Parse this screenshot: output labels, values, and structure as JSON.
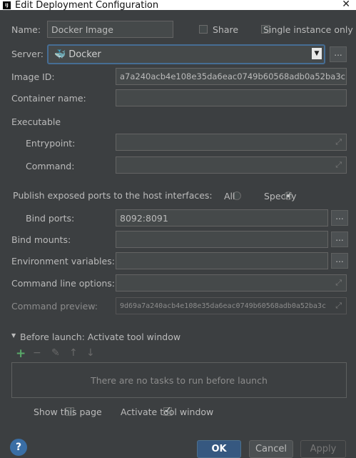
{
  "window": {
    "title": "Edit Deployment Configuration",
    "close_glyph": "✕"
  },
  "name": {
    "label": "Name:",
    "value": "Docker Image"
  },
  "share": {
    "label": "Share"
  },
  "single_instance": {
    "label": "Single instance only"
  },
  "server": {
    "label": "Server:",
    "value": "Docker",
    "more": "..."
  },
  "image_id": {
    "label": "Image ID:",
    "value": "a7a240acb4e108e35da6eac0749b60568adb0a52ba3c"
  },
  "container_name": {
    "label": "Container name:",
    "value": ""
  },
  "executable": {
    "section": "Executable",
    "entrypoint": {
      "label": "Entrypoint:",
      "value": ""
    },
    "command": {
      "label": "Command:",
      "value": ""
    }
  },
  "publish": {
    "label": "Publish exposed ports to the host interfaces:",
    "all": "All",
    "specify": "Specify",
    "selected": "Specify"
  },
  "bind_ports": {
    "label": "Bind ports:",
    "value": "8092:8091",
    "more": "..."
  },
  "bind_mounts": {
    "label": "Bind mounts:",
    "value": "",
    "more": "..."
  },
  "env_vars": {
    "label": "Environment variables:",
    "value": "",
    "more": "..."
  },
  "cmd_options": {
    "label": "Command line options:",
    "value": ""
  },
  "cmd_preview": {
    "label": "Command preview:",
    "value": "9d69a7a240acb4e108e35da6eac0749b60568adb0a52ba3c"
  },
  "before_launch": {
    "label": "Before launch: Activate tool window",
    "empty_text": "There are no tasks to run before launch"
  },
  "show_page": {
    "label": "Show this page",
    "checked": false
  },
  "activate_tool": {
    "label": "Activate tool window",
    "checked": true
  },
  "buttons": {
    "ok": "OK",
    "cancel": "Cancel",
    "apply": "Apply",
    "help": "?"
  },
  "colors": {
    "background": "#3c3f41",
    "field": "#45494a",
    "primary": "#365880",
    "add": "#59a869"
  }
}
